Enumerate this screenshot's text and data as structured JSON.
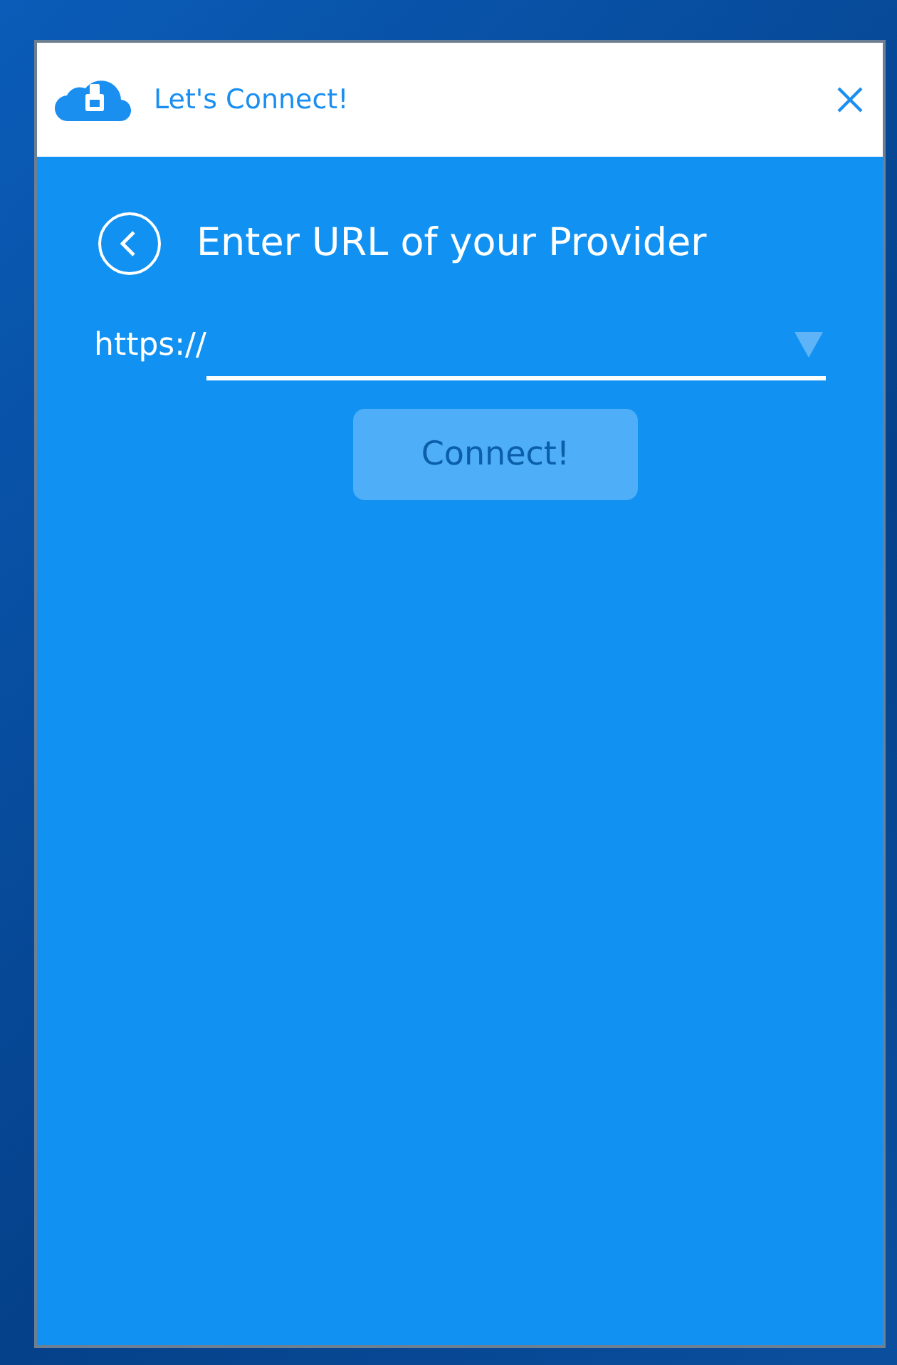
{
  "window": {
    "title": "Let's Connect!"
  },
  "heading": "Enter URL of your Provider",
  "url_field": {
    "prefix": "https://"
  },
  "connect_button": {
    "label": "Connect!",
    "disabled": true
  }
}
